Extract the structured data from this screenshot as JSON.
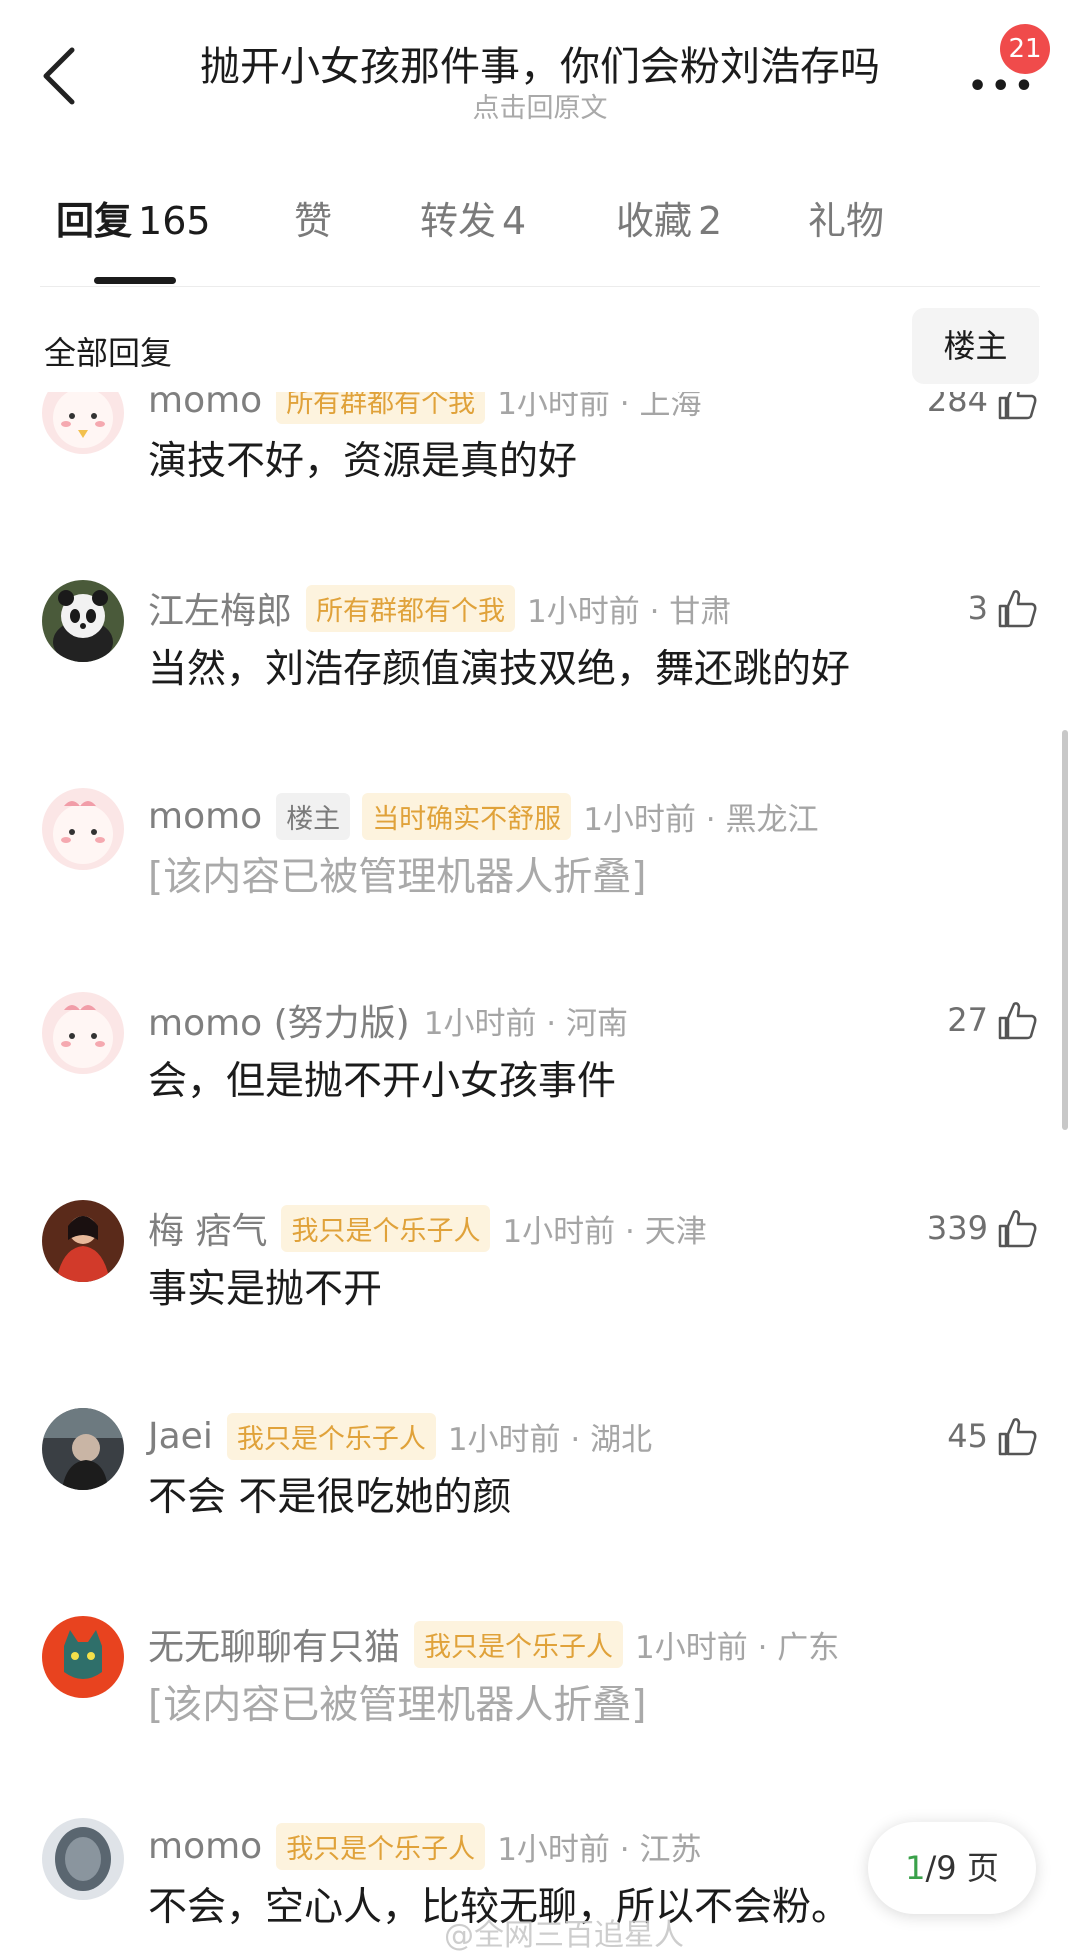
{
  "header": {
    "title": "抛开小女孩那件事，你们会粉刘浩存吗",
    "subtitle": "点击回原文",
    "more_icon": "more-dots-icon",
    "notification_count": "21"
  },
  "tabs": [
    {
      "label": "回复",
      "count": "165",
      "active": true
    },
    {
      "label": "赞",
      "count": ""
    },
    {
      "label": "转发",
      "count": "4"
    },
    {
      "label": "收藏",
      "count": "2"
    },
    {
      "label": "礼物",
      "count": ""
    }
  ],
  "section": {
    "title": "全部回复",
    "owner_filter": "楼主"
  },
  "comments": [
    {
      "user": "momo",
      "role": "",
      "flair": "所有群都有个我",
      "time": "1小时前 · 上海",
      "likes": "284",
      "text": "演技不好，资源是真的好",
      "folded": false,
      "avatar": "pink-dino-avatar"
    },
    {
      "user": "江左梅郎",
      "role": "",
      "flair": "所有群都有个我",
      "time": "1小时前 · 甘肃",
      "likes": "3",
      "text": "当然，刘浩存颜值演技双绝，舞还跳的好",
      "folded": false,
      "avatar": "panda-avatar"
    },
    {
      "user": "momo",
      "role": "楼主",
      "flair": "当时确实不舒服",
      "time": "1小时前 · 黑龙江",
      "likes": "",
      "text": "[该内容已被管理机器人折叠]",
      "folded": true,
      "avatar": "pink-dino-avatar"
    },
    {
      "user": "momo (努力版)",
      "role": "",
      "flair": "",
      "time": "1小时前 · 河南",
      "likes": "27",
      "text": "会，但是抛不开小女孩事件",
      "folded": false,
      "avatar": "pink-dino-avatar"
    },
    {
      "user": "梅 痞气",
      "role": "",
      "flair": "我只是个乐子人",
      "time": "1小时前 · 天津",
      "likes": "339",
      "text": "事实是抛不开",
      "folded": false,
      "avatar": "red-dress-avatar"
    },
    {
      "user": "Jaei",
      "role": "",
      "flair": "我只是个乐子人",
      "time": "1小时前 · 湖北",
      "likes": "45",
      "text": "不会 不是很吃她的颜",
      "folded": false,
      "avatar": "dark-photo-avatar"
    },
    {
      "user": "无无聊聊有只猫",
      "role": "",
      "flair": "我只是个乐子人",
      "time": "1小时前 · 广东",
      "likes": "",
      "text": "[该内容已被管理机器人折叠]",
      "folded": true,
      "avatar": "cat-avatar"
    },
    {
      "user": "momo",
      "role": "",
      "flair": "我只是个乐子人",
      "time": "1小时前 · 江苏",
      "likes": "",
      "text": "不会，空心人，比较无聊，所以不会粉。",
      "folded": false,
      "avatar": "blurred-avatar"
    }
  ],
  "pager": {
    "current": "1",
    "total_text": "/9 页"
  },
  "watermark": "@全网三百追星人",
  "colors": {
    "flair_text": "#e0a23a",
    "flair_bg": "#fdf3de",
    "badge": "#f04b4b",
    "pager_current": "#3aa14a"
  }
}
